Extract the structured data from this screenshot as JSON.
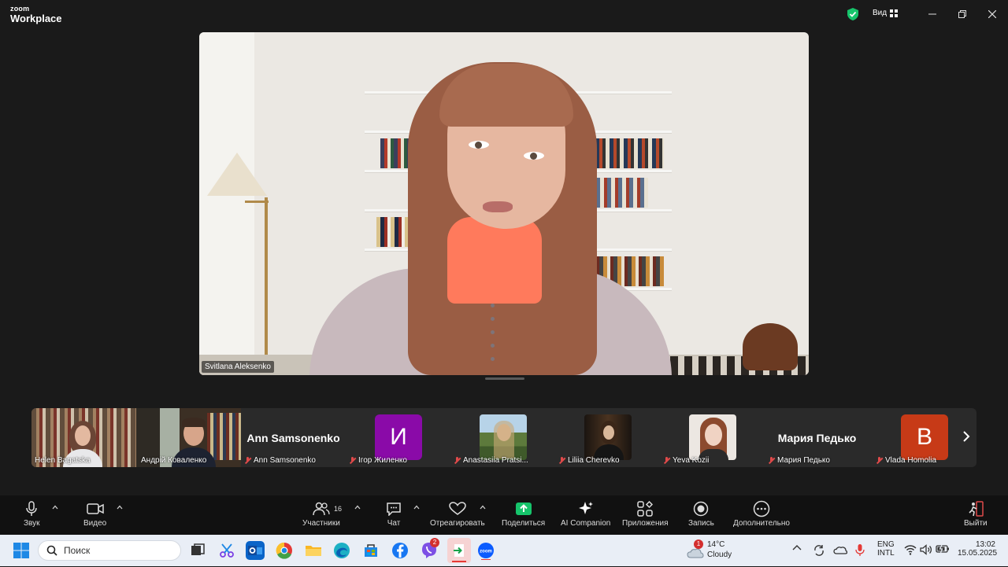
{
  "app": {
    "logo_top": "zoom",
    "logo_bottom": "Workplace",
    "view_label": "Вид"
  },
  "main_video": {
    "speaker_name": "Svitlana Aleksenko"
  },
  "gallery": {
    "tiles": [
      {
        "name": "Helen Bagatska",
        "type": "video",
        "muted": false
      },
      {
        "name": "Андрій Коваленко",
        "type": "video",
        "muted": false
      },
      {
        "name": "Ann Samsonenko",
        "big_name": "Ann Samsonenko",
        "type": "name",
        "muted": true
      },
      {
        "name": "Ігор Жиленко",
        "avatar_letter": "И",
        "avatar_color": "#8a0aa8",
        "type": "avatar",
        "muted": true
      },
      {
        "name": "Anastasiia Pratsi...",
        "type": "photo",
        "muted": true
      },
      {
        "name": "Liliia Cherevko",
        "type": "photo",
        "muted": true
      },
      {
        "name": "Yeva Kozii",
        "type": "photo",
        "muted": true
      },
      {
        "name": "Мария Педько",
        "big_name": "Мария Педько",
        "type": "name",
        "muted": true
      },
      {
        "name": "Vlada Homolia",
        "avatar_letter": "B",
        "avatar_color": "#c73a17",
        "type": "avatar",
        "muted": true
      }
    ]
  },
  "toolbar": {
    "audio": "Звук",
    "video": "Видео",
    "participants": "Участники",
    "participants_count": "16",
    "chat": "Чат",
    "react": "Отреагировать",
    "share": "Поделиться",
    "ai": "AI Companion",
    "apps": "Приложения",
    "record": "Запись",
    "more": "Дополнительно",
    "leave": "Выйти"
  },
  "taskbar": {
    "search_placeholder": "Поиск",
    "weather_temp": "14°C",
    "weather_desc": "Cloudy",
    "weather_badge": "1",
    "viber_badge": "2",
    "lang_top": "ENG",
    "lang_bottom": "INTL",
    "time": "13:02",
    "date": "15.05.2025"
  },
  "colors": {
    "accent_green": "#0e9f55",
    "share_green": "#16c46b",
    "mic_off_red": "#e04a4a"
  }
}
